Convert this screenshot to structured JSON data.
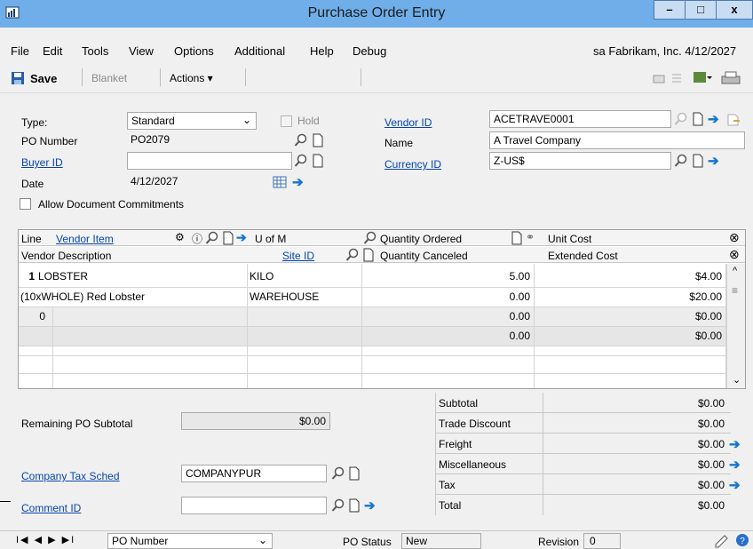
{
  "window": {
    "title": "Purchase Order Entry",
    "min": "–",
    "max": "□",
    "close": "x"
  },
  "menu": {
    "items": [
      "File",
      "Edit",
      "Tools",
      "View",
      "Options",
      "Additional",
      "Help",
      "Debug"
    ],
    "status": "sa  Fabrikam, Inc. 4/12/2027"
  },
  "toolbar": {
    "save": "Save",
    "blanket": "Blanket",
    "actions": "Actions ▾"
  },
  "header": {
    "type_label": "Type:",
    "type_value": "Standard",
    "hold_label": "Hold",
    "po_number_label": "PO Number",
    "po_number_value": "PO2079",
    "buyer_id_label": "Buyer ID",
    "buyer_id_value": "",
    "date_label": "Date",
    "date_value": "4/12/2027",
    "allow_commitments_label": "Allow Document Commitments",
    "vendor_id_label": "Vendor ID",
    "vendor_id_value": "ACETRAVE0001",
    "name_label": "Name",
    "name_value": "A Travel Company",
    "currency_id_label": "Currency ID",
    "currency_id_value": "Z-US$"
  },
  "grid": {
    "headers1": {
      "line": "Line",
      "vendor_item": "Vendor Item",
      "uofm": "U of M",
      "qty_ordered": "Quantity Ordered",
      "unit_cost": "Unit Cost"
    },
    "headers2": {
      "vendor_desc": "Vendor Description",
      "site_id": "Site ID",
      "qty_canceled": "Quantity Canceled",
      "extended_cost": "Extended Cost"
    },
    "rows": [
      {
        "line": "1",
        "item": "LOBSTER",
        "uofm": "KILO",
        "qty": "5.00",
        "cost": "$4.00"
      },
      {
        "line": "",
        "item": "(10xWHOLE) Red Lobster",
        "uofm": "WAREHOUSE",
        "qty": "0.00",
        "cost": "$20.00"
      },
      {
        "line": "0",
        "item": "",
        "uofm": "",
        "qty": "0.00",
        "cost": "$0.00"
      },
      {
        "line": "",
        "item": "",
        "uofm": "",
        "qty": "0.00",
        "cost": "$0.00"
      }
    ]
  },
  "totals": {
    "remaining_label": "Remaining PO Subtotal",
    "remaining_value": "$0.00",
    "subtotal_label": "Subtotal",
    "subtotal_value": "$0.00",
    "trade_label": "Trade Discount",
    "trade_value": "$0.00",
    "freight_label": "Freight",
    "freight_value": "$0.00",
    "misc_label": "Miscellaneous",
    "misc_value": "$0.00",
    "tax_label": "Tax",
    "tax_value": "$0.00",
    "total_label": "Total",
    "total_value": "$0.00"
  },
  "footer": {
    "company_tax_label": "Company Tax Sched",
    "company_tax_value": "COMPANYPUR",
    "comment_id_label": "Comment ID",
    "comment_id_value": ""
  },
  "statusbar": {
    "nav_sort": "PO Number",
    "po_status_label": "PO Status",
    "po_status_value": "New",
    "revision_label": "Revision",
    "revision_value": "0"
  }
}
